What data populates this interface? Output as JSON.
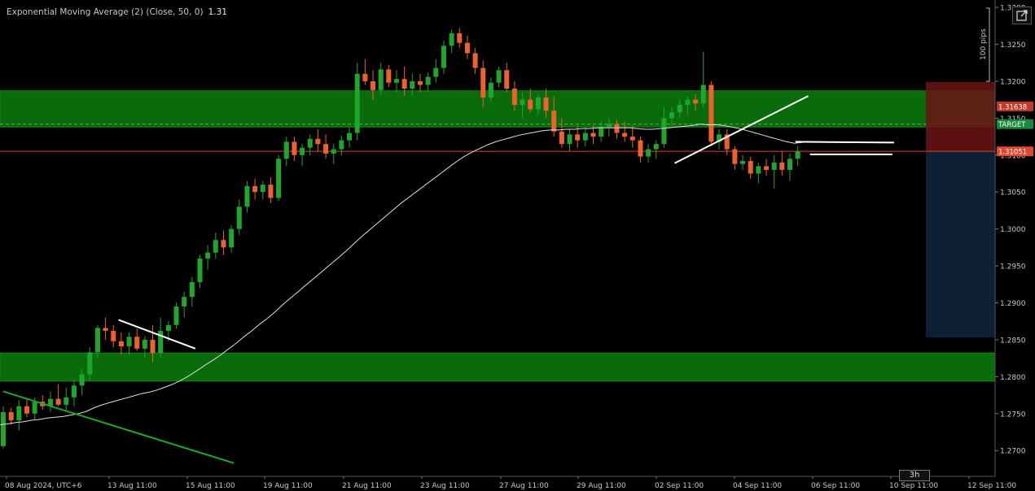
{
  "indicator": {
    "label": "Exponential Moving Average (2) (Close, 50, 0)",
    "value": "1.31"
  },
  "range_ruler": {
    "label": "100 pips"
  },
  "timeframe_badge": "3h",
  "colors": {
    "background": "#000000",
    "bull": "#1fa62d",
    "bear": "#f0602c",
    "zone": "#0a6b0a",
    "ema": "#e0e0e0",
    "price_line": "#d9453a",
    "stop_zone": "#6b1414",
    "target_zone": "#0e2238",
    "axis_text": "#c8c8c8"
  },
  "chart_data": {
    "type": "candlestick",
    "symbol_timezone": "UTC+6",
    "ylim": [
      1.2665,
      1.331
    ],
    "y_ticks": [
      "1.3300",
      "1.3250",
      "1.3200",
      "1.3150",
      "1.3100",
      "1.3050",
      "1.3000",
      "1.2950",
      "1.2900",
      "1.2850",
      "1.2800",
      "1.2750",
      "1.2700"
    ],
    "x_ticks": [
      "08 Aug 2024, UTC+6",
      "13 Aug 11:00",
      "15 Aug 11:00",
      "19 Aug 11:00",
      "21 Aug 11:00",
      "23 Aug 11:00",
      "27 Aug 11:00",
      "29 Aug 11:00",
      "02 Sep 11:00",
      "04 Sep 11:00",
      "06 Sep 11:00",
      "10 Sep 11:00",
      "12 Sep 11:00"
    ],
    "price_labels": [
      {
        "text": "1.31638",
        "price": 1.3166,
        "kind": "stop"
      },
      {
        "text": "TARGET",
        "price": 1.3142,
        "kind": "target"
      },
      {
        "text": "1.31051",
        "price": 1.3105,
        "kind": "current"
      }
    ],
    "current_price": 1.31051,
    "zones": [
      {
        "name": "resistance-zone",
        "from": 1.3138,
        "to": 1.3187
      },
      {
        "name": "support-zone",
        "from": 1.2794,
        "to": 1.2832
      }
    ],
    "target_dash_price": 1.3142,
    "position": {
      "entry": 1.3105,
      "stop": 1.3155,
      "take_profit": 1.2853,
      "stop_top": 1.3199
    },
    "trendlines": [
      {
        "name": "green-downtrend",
        "color": "#1fa62d",
        "from": [
          0,
          1.278
        ],
        "to": [
          126,
          1.2683
        ]
      },
      {
        "name": "flag-line",
        "color": "#ffffff",
        "from": [
          63,
          1.2877
        ],
        "to": [
          105,
          1.2838
        ]
      },
      {
        "name": "rising-trendline",
        "color": "#ffffff",
        "from": [
          367,
          1.3089
        ],
        "to": [
          440,
          1.318
        ]
      },
      {
        "name": "horizontal-line-upper",
        "color": "#ffffff",
        "from": [
          433,
          1.3118
        ],
        "to": [
          487,
          1.3117
        ]
      },
      {
        "name": "horizontal-line-lower",
        "color": "#ffffff",
        "from": [
          441,
          1.3101
        ],
        "to": [
          486,
          1.3101
        ]
      }
    ],
    "ohlc": [
      [
        1.2706,
        1.276,
        1.2703,
        1.2752
      ],
      [
        1.2752,
        1.2758,
        1.2735,
        1.2741
      ],
      [
        1.2741,
        1.2768,
        1.2727,
        1.276
      ],
      [
        1.276,
        1.277,
        1.2745,
        1.275
      ],
      [
        1.275,
        1.2772,
        1.2742,
        1.2766
      ],
      [
        1.2766,
        1.2775,
        1.2755,
        1.276
      ],
      [
        1.276,
        1.278,
        1.2752,
        1.277
      ],
      [
        1.277,
        1.279,
        1.276,
        1.2762
      ],
      [
        1.2762,
        1.2785,
        1.2755,
        1.2772
      ],
      [
        1.2772,
        1.2795,
        1.276,
        1.2788
      ],
      [
        1.2788,
        1.281,
        1.2775,
        1.2803
      ],
      [
        1.2803,
        1.284,
        1.2795,
        1.2833
      ],
      [
        1.2833,
        1.287,
        1.2825,
        1.2866
      ],
      [
        1.2866,
        1.288,
        1.285,
        1.2862
      ],
      [
        1.2862,
        1.287,
        1.284,
        1.2848
      ],
      [
        1.2848,
        1.286,
        1.283,
        1.2841
      ],
      [
        1.2841,
        1.286,
        1.283,
        1.2854
      ],
      [
        1.2854,
        1.2865,
        1.2835,
        1.2838
      ],
      [
        1.2838,
        1.2855,
        1.2825,
        1.285
      ],
      [
        1.285,
        1.287,
        1.282,
        1.2832
      ],
      [
        1.2832,
        1.288,
        1.2826,
        1.2862
      ],
      [
        1.2862,
        1.2875,
        1.2848,
        1.287
      ],
      [
        1.287,
        1.29,
        1.2865,
        1.2895
      ],
      [
        1.2895,
        1.2915,
        1.288,
        1.2908
      ],
      [
        1.2908,
        1.2935,
        1.2895,
        1.2928
      ],
      [
        1.2928,
        1.2965,
        1.292,
        1.296
      ],
      [
        1.296,
        1.2978,
        1.2945,
        1.2968
      ],
      [
        1.2968,
        1.2995,
        1.296,
        1.2985
      ],
      [
        1.2985,
        1.2998,
        1.2965,
        1.2975
      ],
      [
        1.2975,
        1.3005,
        1.2968,
        1.3
      ],
      [
        1.3,
        1.304,
        1.2992,
        1.303
      ],
      [
        1.303,
        1.3065,
        1.3022,
        1.3058
      ],
      [
        1.3058,
        1.3068,
        1.304,
        1.305
      ],
      [
        1.305,
        1.3065,
        1.304,
        1.306
      ],
      [
        1.306,
        1.307,
        1.3035,
        1.3042
      ],
      [
        1.3042,
        1.31,
        1.3038,
        1.3095
      ],
      [
        1.3095,
        1.3125,
        1.3085,
        1.3118
      ],
      [
        1.3118,
        1.3125,
        1.3092,
        1.31
      ],
      [
        1.31,
        1.3115,
        1.3085,
        1.311
      ],
      [
        1.311,
        1.3128,
        1.31,
        1.3122
      ],
      [
        1.3122,
        1.3135,
        1.3105,
        1.3115
      ],
      [
        1.3115,
        1.3128,
        1.3095,
        1.3102
      ],
      [
        1.3102,
        1.3115,
        1.3088,
        1.3108
      ],
      [
        1.3108,
        1.3126,
        1.31,
        1.312
      ],
      [
        1.312,
        1.3138,
        1.311,
        1.313
      ],
      [
        1.313,
        1.3225,
        1.312,
        1.321
      ],
      [
        1.321,
        1.323,
        1.3195,
        1.32
      ],
      [
        1.32,
        1.3215,
        1.3175,
        1.3188
      ],
      [
        1.3188,
        1.3225,
        1.3182,
        1.3216
      ],
      [
        1.3216,
        1.3222,
        1.3192,
        1.3198
      ],
      [
        1.3198,
        1.3215,
        1.3185,
        1.3203
      ],
      [
        1.3203,
        1.322,
        1.318,
        1.319
      ],
      [
        1.319,
        1.321,
        1.318,
        1.32
      ],
      [
        1.32,
        1.321,
        1.3185,
        1.3195
      ],
      [
        1.3195,
        1.3212,
        1.3185,
        1.3206
      ],
      [
        1.3206,
        1.323,
        1.3198,
        1.3218
      ],
      [
        1.3218,
        1.3255,
        1.321,
        1.3248
      ],
      [
        1.3248,
        1.327,
        1.3238,
        1.3265
      ],
      [
        1.3265,
        1.3272,
        1.3245,
        1.3252
      ],
      [
        1.3252,
        1.3262,
        1.323,
        1.3238
      ],
      [
        1.3238,
        1.3245,
        1.321,
        1.3218
      ],
      [
        1.3218,
        1.3228,
        1.3165,
        1.3178
      ],
      [
        1.3178,
        1.3205,
        1.3172,
        1.3198
      ],
      [
        1.3198,
        1.322,
        1.3192,
        1.3215
      ],
      [
        1.3215,
        1.3225,
        1.3185,
        1.319
      ],
      [
        1.319,
        1.32,
        1.316,
        1.3168
      ],
      [
        1.3168,
        1.3185,
        1.315,
        1.3175
      ],
      [
        1.3175,
        1.319,
        1.3158,
        1.3162
      ],
      [
        1.3162,
        1.3182,
        1.3155,
        1.3178
      ],
      [
        1.3178,
        1.319,
        1.315,
        1.316
      ],
      [
        1.316,
        1.318,
        1.3125,
        1.3132
      ],
      [
        1.3132,
        1.315,
        1.311,
        1.3115
      ],
      [
        1.3115,
        1.3135,
        1.3105,
        1.3128
      ],
      [
        1.3128,
        1.314,
        1.311,
        1.312
      ],
      [
        1.312,
        1.3138,
        1.3112,
        1.313
      ],
      [
        1.313,
        1.314,
        1.3115,
        1.3125
      ],
      [
        1.3125,
        1.3145,
        1.3118,
        1.3138
      ],
      [
        1.3138,
        1.315,
        1.3125,
        1.3142
      ],
      [
        1.3142,
        1.3148,
        1.3122,
        1.313
      ],
      [
        1.313,
        1.3145,
        1.3118,
        1.3125
      ],
      [
        1.3125,
        1.314,
        1.311,
        1.312
      ],
      [
        1.312,
        1.3125,
        1.309,
        1.3098
      ],
      [
        1.3098,
        1.3115,
        1.309,
        1.3108
      ],
      [
        1.3108,
        1.312,
        1.3095,
        1.3115
      ],
      [
        1.3115,
        1.3165,
        1.311,
        1.315
      ],
      [
        1.315,
        1.3165,
        1.314,
        1.3158
      ],
      [
        1.3158,
        1.3175,
        1.315,
        1.3168
      ],
      [
        1.3168,
        1.318,
        1.3155,
        1.3175
      ],
      [
        1.3175,
        1.3182,
        1.316,
        1.317
      ],
      [
        1.317,
        1.324,
        1.3165,
        1.3195
      ],
      [
        1.3195,
        1.32,
        1.3112,
        1.3118
      ],
      [
        1.3118,
        1.3135,
        1.3108,
        1.3128
      ],
      [
        1.3128,
        1.3135,
        1.31,
        1.3108
      ],
      [
        1.3108,
        1.3112,
        1.308,
        1.3088
      ],
      [
        1.3088,
        1.31,
        1.308,
        1.3092
      ],
      [
        1.3092,
        1.3098,
        1.3068,
        1.3075
      ],
      [
        1.3075,
        1.309,
        1.3062,
        1.3085
      ],
      [
        1.3085,
        1.3095,
        1.3072,
        1.308
      ],
      [
        1.308,
        1.31,
        1.3055,
        1.309
      ],
      [
        1.309,
        1.3105,
        1.3072,
        1.308
      ],
      [
        1.308,
        1.3102,
        1.3065,
        1.3095
      ],
      [
        1.3095,
        1.3112,
        1.3085,
        1.3105
      ]
    ],
    "ema": [
      1.2735,
      1.2736,
      1.2738,
      1.2739,
      1.2741,
      1.2742,
      1.2744,
      1.2745,
      1.2746,
      1.2748,
      1.275,
      1.2753,
      1.2758,
      1.2762,
      1.2765,
      1.2768,
      1.2771,
      1.2774,
      1.2777,
      1.2779,
      1.2782,
      1.2786,
      1.279,
      1.2795,
      1.2801,
      1.2808,
      1.2815,
      1.2822,
      1.2829,
      1.2837,
      1.2845,
      1.2854,
      1.2862,
      1.2871,
      1.2879,
      1.2888,
      1.2898,
      1.2907,
      1.2916,
      1.2925,
      1.2934,
      1.2943,
      1.2952,
      1.2961,
      1.297,
      1.298,
      1.299,
      1.2999,
      1.3008,
      1.3017,
      1.3026,
      1.3035,
      1.3043,
      1.3051,
      1.3059,
      1.3067,
      1.3075,
      1.3083,
      1.3091,
      1.3098,
      1.3104,
      1.3109,
      1.3114,
      1.3118,
      1.3121,
      1.3124,
      1.3127,
      1.3129,
      1.3131,
      1.3133,
      1.3134,
      1.3134,
      1.3135,
      1.3135,
      1.3136,
      1.3136,
      1.3137,
      1.3137,
      1.3137,
      1.3137,
      1.3137,
      1.3136,
      1.3135,
      1.3135,
      1.3136,
      1.3137,
      1.3138,
      1.3139,
      1.314,
      1.3142,
      1.3141,
      1.3141,
      1.314,
      1.3138,
      1.3136,
      1.3133,
      1.313,
      1.3127,
      1.3124,
      1.3121,
      1.3118,
      1.3116
    ]
  }
}
